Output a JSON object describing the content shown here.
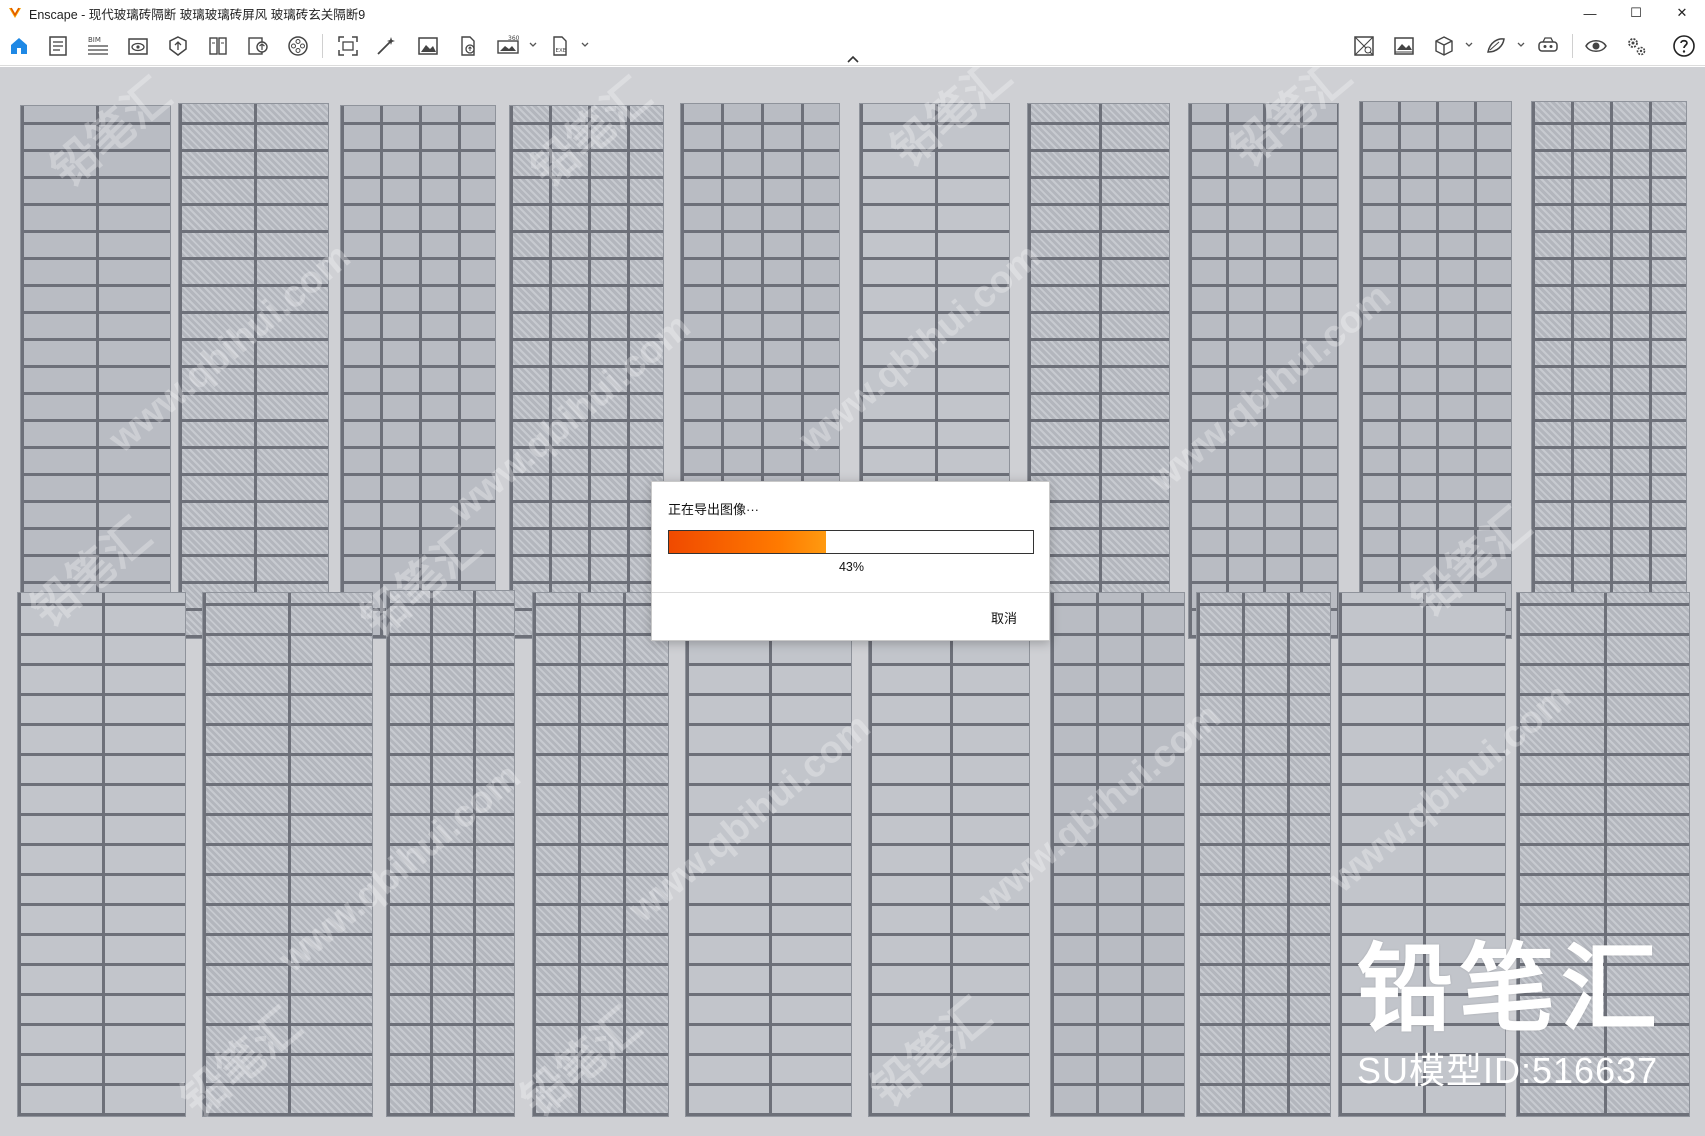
{
  "window": {
    "title": "Enscape - 现代玻璃砖隔断 玻璃玻璃砖屏风 玻璃砖玄关隔断9",
    "minimize_glyph": "—",
    "maximize_glyph": "☐",
    "close_glyph": "✕"
  },
  "toolbar": {
    "left_icons": [
      "home-icon",
      "document-icon",
      "bim-icon",
      "view-icon",
      "asset-icon",
      "library-icon",
      "upload-icon",
      "video-icon",
      "screenshot-icon",
      "magic-icon",
      "image-icon",
      "export-icon",
      "panorama-360-icon",
      "exe-export-icon"
    ],
    "right_icons": [
      "map-icon",
      "gallery-icon",
      "cube-icon",
      "material-icon",
      "vr-icon",
      "eye-icon",
      "settings-icon",
      "help-icon"
    ],
    "bim_label": "BIM",
    "panorama_label": "360",
    "exe_label": "EXE",
    "accent_color": "#1e88e5"
  },
  "dialog": {
    "title": "正在导出图像···",
    "progress": 43,
    "progress_label": "43%",
    "cancel_label": "取消",
    "progress_color": "#f04a00"
  },
  "watermark": {
    "brand_name": "铅笔汇",
    "model_id": "SU模型ID:516637",
    "site_text": "www.qbihui.com",
    "stamp_text": "铅笔汇"
  }
}
